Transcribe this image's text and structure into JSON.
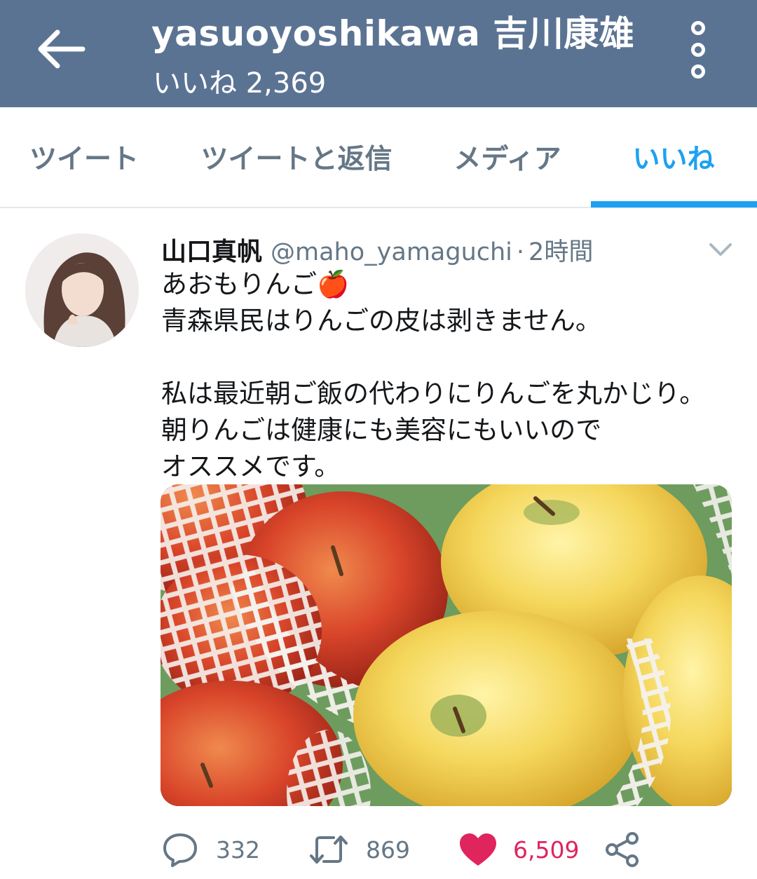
{
  "header": {
    "title": "yasuoyoshikawa 吉川康雄",
    "subtitle": "いいね 2,369"
  },
  "tabs": [
    {
      "label": "ツイート",
      "active": false
    },
    {
      "label": "ツイートと返信",
      "active": false
    },
    {
      "label": "メディア",
      "active": false
    },
    {
      "label": "いいね",
      "active": true
    }
  ],
  "tweet": {
    "author_name": "山口真帆",
    "handle": "@maho_yamaguchi",
    "separator": "·",
    "time": "2時間",
    "text_lines": [
      "あおもりんご🍎",
      "青森県民はりんごの皮は剥きません。",
      "",
      "私は最近朝ご飯の代わりにりんごを丸かじり。",
      "朝りんごは健康にも美容にもいいので",
      "オススメです。"
    ],
    "replies": "332",
    "retweets": "869",
    "likes": "6,509"
  },
  "colors": {
    "header_bg": "#5b7393",
    "accent": "#1da1f2",
    "like": "#e0245e",
    "muted": "#657786"
  },
  "icons": [
    "back-arrow-icon",
    "more-vertical-icon",
    "chevron-down-icon",
    "reply-icon",
    "retweet-icon",
    "heart-icon",
    "share-icon"
  ]
}
